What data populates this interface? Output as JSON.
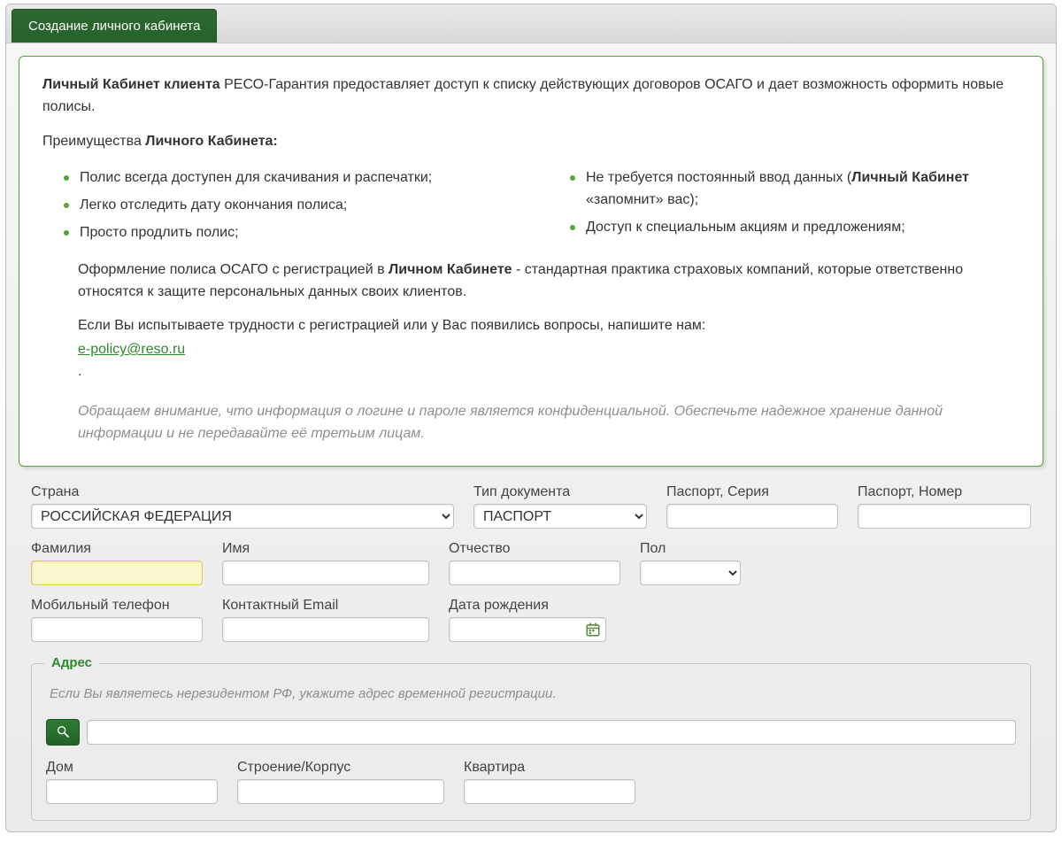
{
  "tab": {
    "title": "Создание личного кабинета"
  },
  "info": {
    "lead_bold": "Личный Кабинет клиента",
    "lead_rest": " РЕСО-Гарантия предоставляет доступ к списку действующих договоров ОСАГО и дает возможность оформить новые полисы.",
    "adv_prefix": "Преимущества ",
    "adv_bold": "Личного Кабинета:",
    "adv_left": [
      "Полис всегда доступен для скачивания и распечатки;",
      "Легко отследить дату окончания полиса;",
      "Просто продлить полис;"
    ],
    "adv_right_1_a": "Не требуется постоянный ввод данных (",
    "adv_right_1_b": "Личный Кабинет",
    "adv_right_1_c": " «запомнит» вас);",
    "adv_right_2": "Доступ к специальным акциям и предложениям;",
    "para2_a": "Оформление полиса ОСАГО с регистрацией в ",
    "para2_b": "Личном Кабинете",
    "para2_c": " - стандартная практика страховых компаний, которые ответственно относятся к защите персональных данных своих клиентов.",
    "para3": "Если Вы испытываете трудности с регистрацией или у Вас появились вопросы, напишите нам:",
    "email": "e-policy@reso.ru",
    "dot": ".",
    "note": "Обращаем внимание, что информация о логине и пароле является конфиденциальной. Обеспечьте надежное хранение данной информации и не передавайте её третьим лицам."
  },
  "labels": {
    "country": "Страна",
    "doc_type": "Тип документа",
    "passport_series": "Паспорт, Серия",
    "passport_number": "Паспорт, Номер",
    "lastname": "Фамилия",
    "firstname": "Имя",
    "middlename": "Отчество",
    "sex": "Пол",
    "phone": "Мобильный телефон",
    "email": "Контактный Email",
    "dob": "Дата рождения",
    "house": "Дом",
    "building": "Строение/Корпус",
    "flat": "Квартира"
  },
  "values": {
    "country": "РОССИЙСКАЯ ФЕДЕРАЦИЯ",
    "doc_type": "ПАСПОРТ",
    "passport_series": "",
    "passport_number": "",
    "lastname": "",
    "firstname": "",
    "middlename": "",
    "sex": "",
    "phone": "",
    "email": "",
    "dob": "",
    "address_search": "",
    "house": "",
    "building": "",
    "flat": ""
  },
  "address": {
    "legend": "Адрес",
    "hint": "Если Вы являетесь нерезидентом РФ, укажите адрес временной регистрации."
  }
}
